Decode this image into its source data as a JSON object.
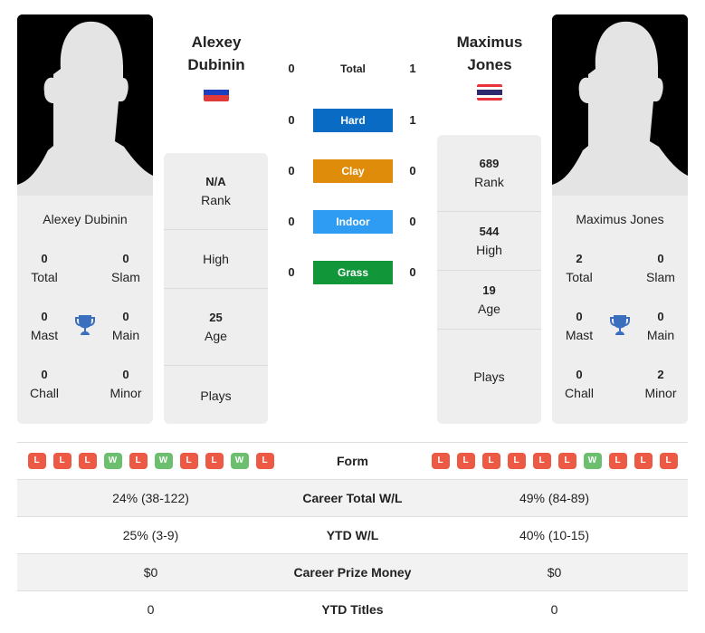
{
  "players": [
    {
      "name_line1": "Alexey",
      "name_line2": "Dubinin",
      "full_name": "Alexey Dubinin",
      "flag": "russia-flag",
      "flag_colors": [
        "#ffffff",
        "#1c3fc0",
        "#e03a3a"
      ],
      "titles": {
        "total": {
          "value": "0",
          "label": "Total"
        },
        "slam": {
          "value": "0",
          "label": "Slam"
        },
        "mast": {
          "value": "0",
          "label": "Mast"
        },
        "main": {
          "value": "0",
          "label": "Main"
        },
        "chall": {
          "value": "0",
          "label": "Chall"
        },
        "minor": {
          "value": "0",
          "label": "Minor"
        }
      },
      "stats": {
        "rank": {
          "value": "N/A",
          "label": "Rank"
        },
        "high": {
          "value": "",
          "label": "High"
        },
        "age": {
          "value": "25",
          "label": "Age"
        },
        "plays": {
          "value": "",
          "label": "Plays"
        }
      },
      "form": [
        "L",
        "L",
        "L",
        "W",
        "L",
        "W",
        "L",
        "L",
        "W",
        "L"
      ],
      "career_total_wl": "24% (38-122)",
      "ytd_wl": "25% (3-9)",
      "career_prize_money": "$0",
      "ytd_titles": "0"
    },
    {
      "name_line1": "Maximus",
      "name_line2": "Jones",
      "full_name": "Maximus Jones",
      "flag": "thailand-flag",
      "flag_colors": [
        "#e8333b",
        "#ffffff",
        "#2d2a6e"
      ],
      "titles": {
        "total": {
          "value": "2",
          "label": "Total"
        },
        "slam": {
          "value": "0",
          "label": "Slam"
        },
        "mast": {
          "value": "0",
          "label": "Mast"
        },
        "main": {
          "value": "0",
          "label": "Main"
        },
        "chall": {
          "value": "0",
          "label": "Chall"
        },
        "minor": {
          "value": "2",
          "label": "Minor"
        }
      },
      "stats": {
        "rank": {
          "value": "689",
          "label": "Rank"
        },
        "high": {
          "value": "544",
          "label": "High"
        },
        "age": {
          "value": "19",
          "label": "Age"
        },
        "plays": {
          "value": "",
          "label": "Plays"
        }
      },
      "form": [
        "L",
        "L",
        "L",
        "L",
        "L",
        "L",
        "W",
        "L",
        "L",
        "L"
      ],
      "career_total_wl": "49% (84-89)",
      "ytd_wl": "40% (10-15)",
      "career_prize_money": "$0",
      "ytd_titles": "0"
    }
  ],
  "h2h": [
    {
      "label": "Total",
      "left": "0",
      "right": "1",
      "color": ""
    },
    {
      "label": "Hard",
      "left": "0",
      "right": "1",
      "color": "#0a6bc4"
    },
    {
      "label": "Clay",
      "left": "0",
      "right": "0",
      "color": "#de8c0a"
    },
    {
      "label": "Indoor",
      "left": "0",
      "right": "0",
      "color": "#2e9cf2"
    },
    {
      "label": "Grass",
      "left": "0",
      "right": "0",
      "color": "#11963a"
    }
  ],
  "table": {
    "form_label": "Form",
    "career_total_wl_label": "Career Total W/L",
    "ytd_wl_label": "YTD W/L",
    "career_prize_money_label": "Career Prize Money",
    "ytd_titles_label": "YTD Titles"
  },
  "colors": {
    "loss": "#ec5a45",
    "win": "#6cbf6f",
    "trophy": "#3a6fc0",
    "card_bg": "#eeeeee"
  }
}
